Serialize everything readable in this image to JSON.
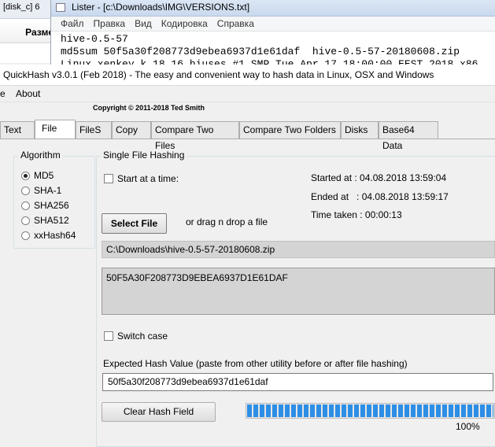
{
  "background": {
    "left_window": {
      "title": "[disk_c]  6",
      "column_header": "Разме"
    },
    "lister": {
      "title": "Lister - [c:\\Downloads\\IMG\\VERSIONS.txt]",
      "menu": [
        "Файл",
        "Правка",
        "Вид",
        "Кодировка",
        "Справка"
      ],
      "lines": [
        "hive-0.5-57",
        "md5sum 50f5a30f208773d9ebea6937d1e61daf  hive-0.5-57-20180608.zip",
        "Linux xenkey k 18.16 hiuses #1 SMP Tue Apr 17 18:00:00 EEST 2018 x86"
      ]
    }
  },
  "app": {
    "title": "QuickHash v3.0.1 (Feb 2018) - The easy and convenient way to hash data in Linux, OSX and Windows",
    "menu": [
      "e",
      "About"
    ],
    "copyright": "Copyright © 2011-2018 Ted Smith"
  },
  "tabs": [
    {
      "label": "Text",
      "active": false
    },
    {
      "label": "File",
      "active": true
    },
    {
      "label": "FileS",
      "active": false
    },
    {
      "label": "Copy",
      "active": false
    },
    {
      "label": "Compare Two Files",
      "active": false
    },
    {
      "label": "Compare Two Folders",
      "active": false
    },
    {
      "label": "Disks",
      "active": false
    },
    {
      "label": "Base64 Data",
      "active": false
    }
  ],
  "algorithm": {
    "label": "Algorithm",
    "options": [
      "MD5",
      "SHA-1",
      "SHA256",
      "SHA512",
      "xxHash64"
    ],
    "selected": "MD5"
  },
  "single_file": {
    "label": "Single File Hashing",
    "start_at_time_label": "Start at a time:",
    "started_at": "Started at : 04.08.2018 13:59:04",
    "ended_at": "Ended at   : 04.08.2018 13:59:17",
    "time_taken": "Time taken : 00:00:13",
    "select_file_button": "Select File",
    "drag_hint": "or drag n drop a file",
    "file_path": "C:\\Downloads\\hive-0.5-57-20180608.zip",
    "hash_result": "50F5A30F208773D9EBEA6937D1E61DAF",
    "switch_case_label": "Switch case",
    "expected_label": "Expected Hash Value (paste from other utility before or after file hashing)",
    "expected_value": "50f5a30f208773d9ebea6937d1e61daf",
    "clear_button": "Clear Hash Field",
    "progress_percent": 100,
    "progress_label": "100%"
  },
  "colors": {
    "progress": "#2d8ee6",
    "readonly_field": "#d4d4d4"
  }
}
